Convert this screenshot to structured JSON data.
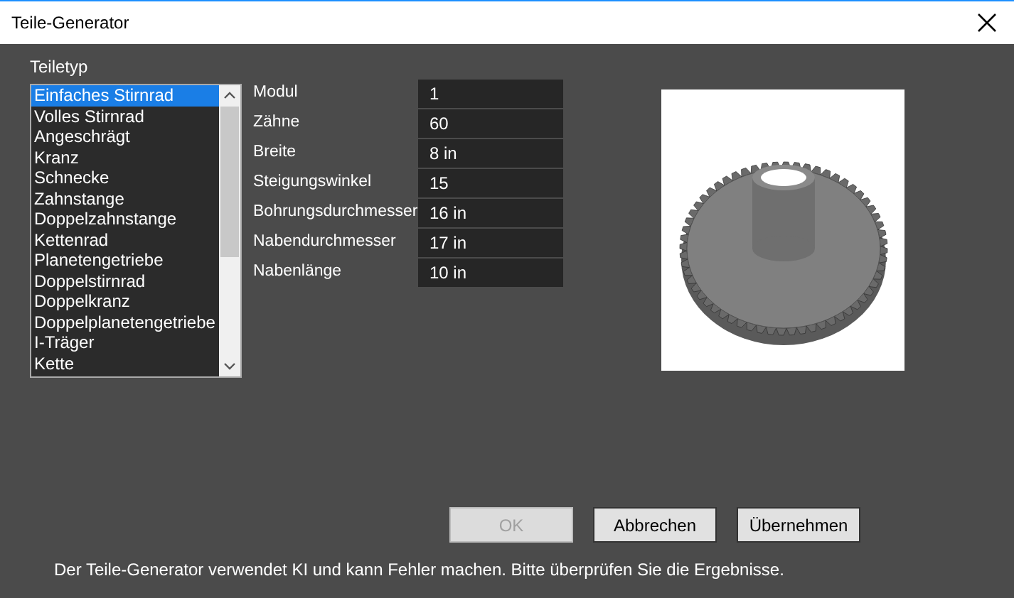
{
  "window": {
    "title": "Teile-Generator"
  },
  "part_type": {
    "label": "Teiletyp",
    "items": [
      {
        "label": "Einfaches Stirnrad",
        "selected": true
      },
      {
        "label": "Volles Stirnrad",
        "selected": false
      },
      {
        "label": "Angeschrägt",
        "selected": false
      },
      {
        "label": "Kranz",
        "selected": false
      },
      {
        "label": "Schnecke",
        "selected": false
      },
      {
        "label": "Zahnstange",
        "selected": false
      },
      {
        "label": "Doppelzahnstange",
        "selected": false
      },
      {
        "label": "Kettenrad",
        "selected": false
      },
      {
        "label": "Planetengetriebe",
        "selected": false
      },
      {
        "label": "Doppelstirnrad",
        "selected": false
      },
      {
        "label": "Doppelkranz",
        "selected": false
      },
      {
        "label": "Doppelplanetengetriebe",
        "selected": false
      },
      {
        "label": "I-Träger",
        "selected": false
      },
      {
        "label": "Kette",
        "selected": false
      }
    ]
  },
  "parameters": [
    {
      "label": "Modul",
      "value": "1"
    },
    {
      "label": "Zähne",
      "value": "60"
    },
    {
      "label": "Breite",
      "value": "8 in"
    },
    {
      "label": "Steigungswinkel",
      "value": "15"
    },
    {
      "label": "Bohrungsdurchmesser",
      "value": "16 in"
    },
    {
      "label": "Nabendurchmesser",
      "value": "17 in"
    },
    {
      "label": "Nabenlänge",
      "value": "10 in"
    }
  ],
  "buttons": [
    {
      "label": "OK",
      "disabled": true
    },
    {
      "label": "Abbrechen",
      "disabled": false
    },
    {
      "label": "Übernehmen",
      "disabled": false
    }
  ],
  "footer": "Der Teile-Generator verwendet KI und kann Fehler machen. Bitte überprüfen Sie die Ergebnisse."
}
